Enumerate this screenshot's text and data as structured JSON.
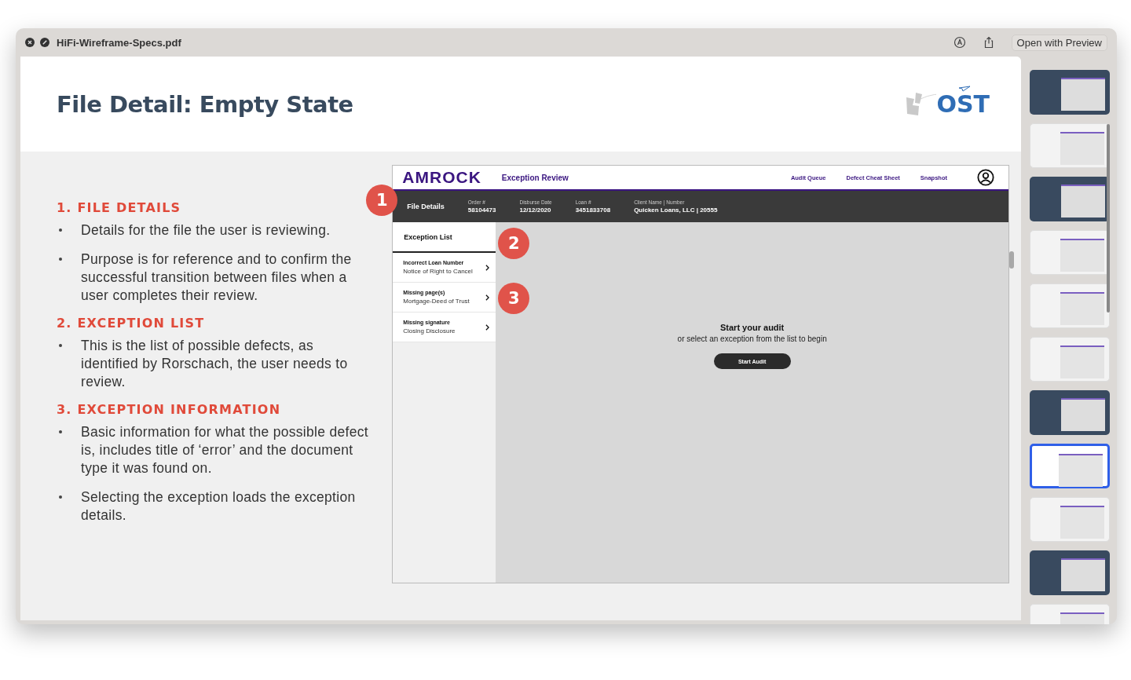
{
  "window": {
    "title": "HiFi-Wireframe-Specs.pdf",
    "open_button": "Open with Preview"
  },
  "slide": {
    "title": "File Detail: Empty State",
    "logo_text": "OST",
    "sections": [
      {
        "heading": "1. FILE DETAILS",
        "bullets": [
          "Details for the file the user is reviewing.",
          "Purpose is for reference and to confirm the successful transition between files when a user completes their review."
        ]
      },
      {
        "heading": "2. EXCEPTION LIST",
        "bullets": [
          "This is the list of possible defects, as identified by Rorschach, the user needs to review."
        ]
      },
      {
        "heading": "3. EXCEPTION INFORMATION",
        "bullets": [
          "Basic information for what the possible defect is, includes title of ‘error’ and the document type it was found on.",
          "Selecting the exception loads the exception details."
        ]
      }
    ],
    "mockup": {
      "brand": "AMROCK",
      "app_title": "Exception Review",
      "nav": [
        "Audit Queue",
        "Defect Cheat Sheet",
        "Snapshot"
      ],
      "file_details": {
        "label": "File Details",
        "fields": [
          {
            "label": "Order #",
            "value": "58104473"
          },
          {
            "label": "Disburse Date",
            "value": "12/12/2020"
          },
          {
            "label": "Loan #",
            "value": "3451833708"
          },
          {
            "label": "Client Name | Number",
            "value": "Quicken Loans, LLC | 20555"
          }
        ]
      },
      "exception_list": {
        "title": "Exception List",
        "items": [
          {
            "title": "Incorrect Loan Number",
            "doc": "Notice of Right to Cancel"
          },
          {
            "title": "Missing page(s)",
            "doc": "Mortgage-Deed of Trust"
          },
          {
            "title": "Missing signature",
            "doc": "Closing Disclosure"
          }
        ]
      },
      "empty_state": {
        "title": "Start your audit",
        "subtitle": "or select an exception from the list to begin",
        "button": "Start Audit"
      },
      "badges": [
        "1",
        "2",
        "3"
      ]
    }
  },
  "thumbnails": [
    {
      "kind": "dark",
      "selected": false
    },
    {
      "kind": "light",
      "selected": false
    },
    {
      "kind": "dark",
      "selected": false
    },
    {
      "kind": "light",
      "selected": false
    },
    {
      "kind": "light",
      "selected": false
    },
    {
      "kind": "light",
      "selected": false
    },
    {
      "kind": "dark",
      "selected": false
    },
    {
      "kind": "light",
      "selected": true
    },
    {
      "kind": "light",
      "selected": false
    },
    {
      "kind": "dark",
      "selected": false
    },
    {
      "kind": "light",
      "selected": false
    }
  ]
}
